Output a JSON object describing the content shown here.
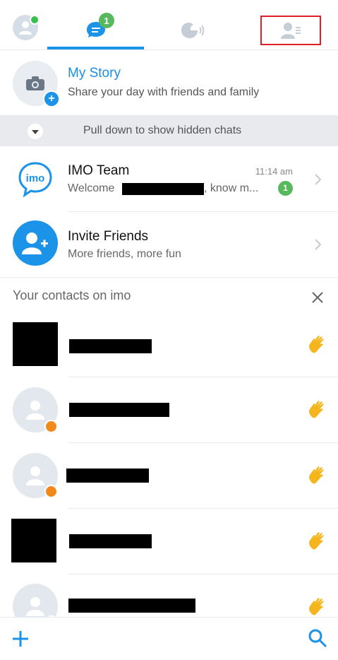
{
  "tabs": {
    "chats_badge": "1"
  },
  "story": {
    "title": "My Story",
    "subtitle": "Share your day with friends and family"
  },
  "hidden_chats": {
    "text": "Pull down to show hidden chats"
  },
  "chats": [
    {
      "name": "IMO Team",
      "time": "11:14 am",
      "preview_start": "Welcome",
      "preview_end": ", know m...",
      "unread": "1",
      "logo_text": "imo"
    }
  ],
  "invite": {
    "title": "Invite Friends",
    "subtitle": "More friends, more fun"
  },
  "contacts_section": {
    "header": "Your contacts on imo"
  },
  "colors": {
    "accent": "#1a93e8",
    "badge_green": "#57b95c",
    "highlight_red": "#e11f26",
    "wave_yellow": "#f5b51c",
    "clock_orange": "#f08a1c"
  },
  "icons": {
    "wave": "waving-hand-icon"
  }
}
